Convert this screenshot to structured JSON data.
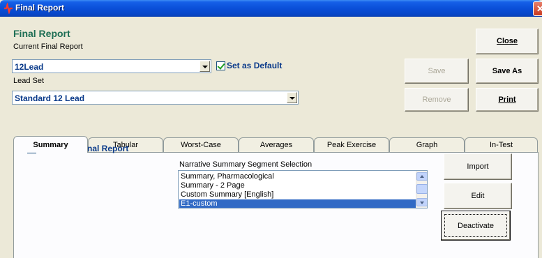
{
  "window": {
    "title": "Final Report",
    "close_glyph": "✕"
  },
  "header": {
    "heading": "Final Report",
    "current_label": "Current Final Report"
  },
  "current_report": {
    "value": "12Lead"
  },
  "set_default": {
    "label": "Set as Default",
    "checked": true
  },
  "lead_set": {
    "label": "Lead Set",
    "value": "Standard 12 Lead"
  },
  "buttons": {
    "close": "Close",
    "save": "Save",
    "save_as": "Save As",
    "remove": "Remove",
    "print": "Print"
  },
  "tabs": [
    "Summary",
    "Tabular",
    "Worst-Case",
    "Averages",
    "Peak Exercise",
    "Graph",
    "In-Test"
  ],
  "active_tab": "Summary",
  "summary": {
    "include_label": "Include in Final Report",
    "include_checked": true,
    "narrative_label": "Narrative Summary Segment Selection",
    "items": [
      "Summary, Pharmacological",
      "Summary - 2 Page",
      "Custom Summary [English]",
      "E1-custom"
    ],
    "selected_index": 3
  },
  "side_buttons": {
    "import": "Import",
    "edit": "Edit",
    "deactivate": "Deactivate"
  },
  "icons": {
    "app": "report-app-icon",
    "dropdown": "chevron-down-icon",
    "close": "close-icon"
  },
  "colors": {
    "title_bar": "#0a4fd8",
    "heading": "#1e6e55",
    "bold_value": "#0a3a8a",
    "selection": "#316ac5"
  }
}
